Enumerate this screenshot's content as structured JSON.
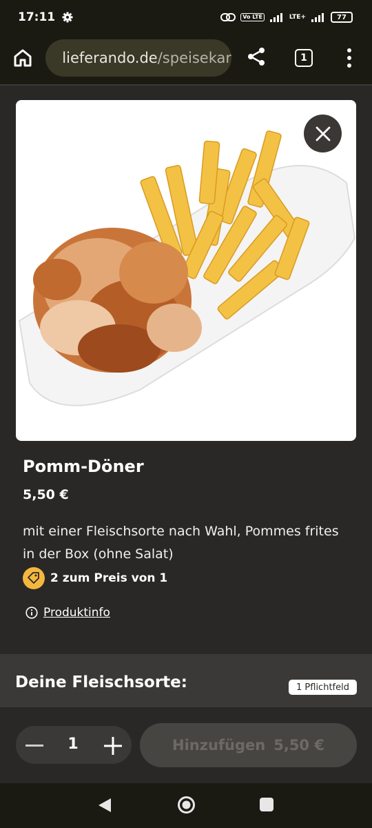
{
  "status_bar": {
    "time": "17:11",
    "volte": "Vo LTE",
    "network": "LTE+",
    "battery": "77"
  },
  "browser": {
    "url_main": "lieferando.de",
    "url_path": "/speisekar",
    "tab_count": "1"
  },
  "product": {
    "name": "Pomm-Döner",
    "price": "5,50 €",
    "description": "mit einer Fleischsorte nach Wahl, Pommes frites in der Box (ohne Salat)",
    "promo": "2 zum Preis von 1",
    "info_link": "Produktinfo"
  },
  "options_section": {
    "title": "Deine Fleischsorte:",
    "badge": "1 Pflichtfeld"
  },
  "cart": {
    "quantity": "1",
    "add_label": "Hinzufügen",
    "add_price": "5,50 €"
  },
  "icons": {
    "home": "home-icon",
    "site_settings": "tune-icon",
    "share": "share-icon",
    "menu": "more-vert-icon",
    "close": "close-icon",
    "promo": "tag-icon",
    "info": "info-icon"
  },
  "colors": {
    "background": "#2a2827",
    "promo_badge": "#f4b83f",
    "add_button_disabled": "#474542"
  }
}
